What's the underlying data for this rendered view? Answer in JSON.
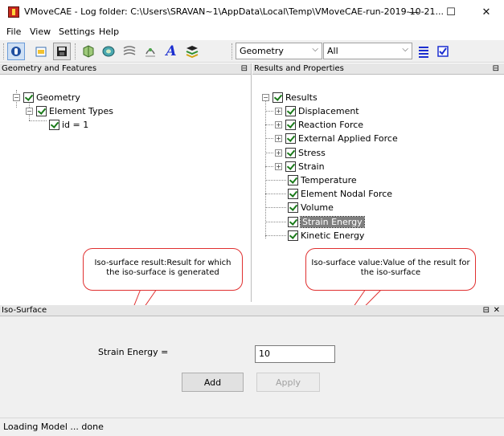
{
  "window": {
    "title": "VMoveCAE - Log folder: C:\\Users\\SRAVAN~1\\AppData\\Local\\Temp\\VMoveCAE-run-2019-10-21...",
    "minimize_glyph": "—",
    "maximize_glyph": "☐",
    "close_glyph": "✕"
  },
  "menu": [
    "File",
    "View",
    "Settings",
    "Help"
  ],
  "toolbar": {
    "combo_type": "Geometry",
    "combo_filter": "All",
    "combo_arrow": "⌵"
  },
  "left_panel": {
    "title": "Geometry and Features",
    "tree": [
      {
        "label": "Geometry"
      },
      {
        "label": "Element Types"
      },
      {
        "label": "id = 1"
      }
    ]
  },
  "right_panel": {
    "title": "Results and Properties",
    "root": "Results",
    "items": [
      {
        "label": "Displacement",
        "expandable": true
      },
      {
        "label": "Reaction Force",
        "expandable": true
      },
      {
        "label": "External Applied Force",
        "expandable": true
      },
      {
        "label": "Stress",
        "expandable": true
      },
      {
        "label": "Strain",
        "expandable": true
      },
      {
        "label": "Temperature",
        "expandable": false
      },
      {
        "label": "Element Nodal Force",
        "expandable": false
      },
      {
        "label": "Volume",
        "expandable": false
      },
      {
        "label": "Strain Energy",
        "expandable": false,
        "selected": true
      },
      {
        "label": "Kinetic Energy",
        "expandable": false
      }
    ]
  },
  "callouts": {
    "left": "Iso-surface result:Result for which the iso-surface is generated",
    "right": "Iso-surface value:Value of the result for the iso-surface"
  },
  "iso_panel": {
    "title": "Iso-Surface",
    "result_label": "Strain Energy =",
    "value": "10",
    "add_label": "Add",
    "apply_label": "Apply"
  },
  "status": "Loading Model ... done",
  "colors": {
    "accent_red": "#e03030",
    "app_icon": "#c8281e",
    "check_green": "#1a7a1a",
    "selection": "#7f7f7f"
  }
}
